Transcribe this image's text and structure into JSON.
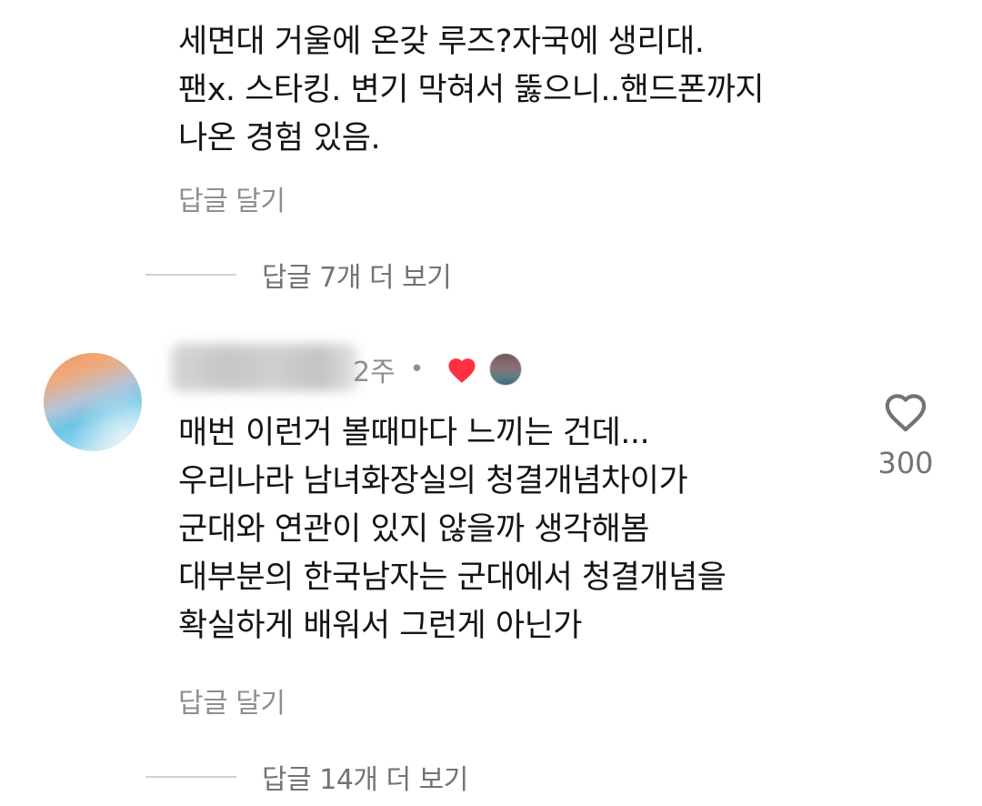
{
  "comment1": {
    "lines": [
      "세면대 거울에 온갖 루즈?자국에 생리대.",
      "팬x. 스타킹. 변기 막혀서 뚫으니..핸드폰까지",
      "나온 경험 있음."
    ],
    "reply_label": "답글 달기",
    "view_replies": "답글 7개 더 보기"
  },
  "comment2": {
    "time": "2주",
    "separator": "•",
    "lines": [
      "매번 이런거 볼때마다 느끼는 건데...",
      "우리나라 남녀화장실의 청결개념차이가",
      "군대와 연관이 있지 않을까 생각해봄",
      "대부분의 한국남자는 군대에서 청결개념을",
      "확실하게 배워서 그런게 아닌가"
    ],
    "like_count": "300",
    "reply_label": "답글 달기",
    "view_replies": "답글 14개 더 보기"
  },
  "icons": {
    "author_like": "heart-filled-icon",
    "like": "heart-outline-icon"
  },
  "colors": {
    "heart_red": "#ff3040",
    "secondary_text": "#8e8e8e",
    "primary_text": "#141414"
  }
}
